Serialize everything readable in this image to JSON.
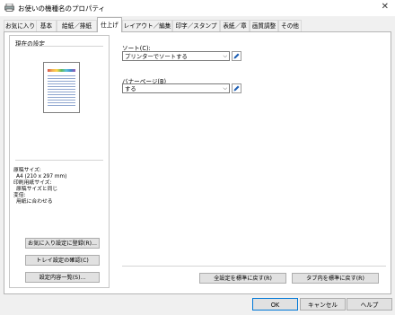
{
  "window": {
    "title": "お使いの機種名のプロパティ"
  },
  "tabs": [
    {
      "label": "お気に入り"
    },
    {
      "label": "基本"
    },
    {
      "label": "給紙／排紙"
    },
    {
      "label": "仕上げ"
    },
    {
      "label": "レイアウト／編集"
    },
    {
      "label": "印字／スタンプ"
    },
    {
      "label": "表紙／章"
    },
    {
      "label": "画質調整"
    },
    {
      "label": "その他"
    }
  ],
  "left_panel": {
    "title": "現在の設定",
    "info_lines": [
      "原稿サイズ:",
      "A4 (210 x 297 mm)",
      "印刷用紙サイズ:",
      "原稿サイズと同じ",
      "変倍:",
      "用紙に合わせる"
    ],
    "buttons": [
      "お気に入り設定に登録(R)...",
      "トレイ設定の確認(C)",
      "設定内容一覧(S)..."
    ]
  },
  "sort": {
    "label": "ソート(C):",
    "value": "プリンターでソートする"
  },
  "banner": {
    "label": "バナーページ(B)",
    "value": "する"
  },
  "reset_buttons": [
    "全設定を標準に戻す(R)",
    "タブ内を標準に戻す(R)"
  ],
  "dialog_buttons": [
    "OK",
    "キャンセル",
    "ヘルプ"
  ],
  "colors": {
    "accent": "#0078d7",
    "pencil_blue": "#1e5fb4"
  }
}
